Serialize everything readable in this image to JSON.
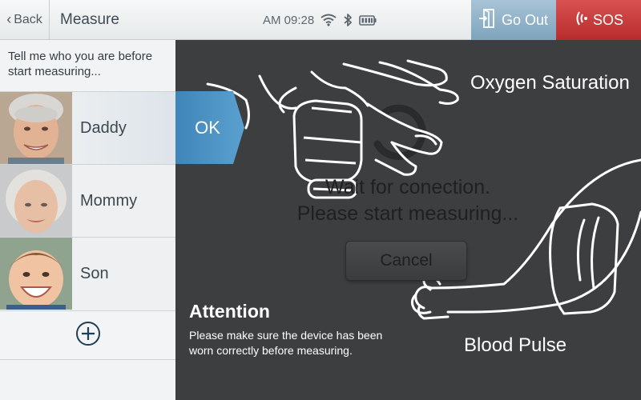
{
  "header": {
    "back_label": "Back",
    "title": "Measure",
    "time": "AM 09:28",
    "goout_label": "Go Out",
    "sos_label": "SOS",
    "icons": {
      "back": "chevron-left-icon",
      "wifi": "wifi-icon",
      "bluetooth": "bluetooth-icon",
      "battery": "battery-icon",
      "goout": "exit-door-icon",
      "sos": "sos-signal-icon"
    },
    "colors": {
      "goout": "#8aaec6",
      "sos": "#c83a3a"
    }
  },
  "sidebar": {
    "prompt": "Tell me who you are before start measuring...",
    "profiles": [
      {
        "name": "Daddy",
        "selected": true
      },
      {
        "name": "Mommy",
        "selected": false
      },
      {
        "name": "Son",
        "selected": false
      }
    ],
    "add_icon": "plus-circle-icon"
  },
  "main": {
    "ok_label": "OK",
    "message_line1": "Wait for conection.",
    "message_line2": "Please start measuring...",
    "cancel_label": "Cancel",
    "label_oxygen": "Oxygen Saturation",
    "label_pulse": "Blood Pulse",
    "attention_title": "Attention",
    "attention_body": "Please make sure the device has been worn correctly before measuring.",
    "icons": {
      "spinner": "loading-spinner-icon",
      "finger_sensor": "finger-oximeter-illustration",
      "arm_cuff": "arm-blood-pressure-cuff-illustration"
    },
    "colors": {
      "background": "#3d3e3f",
      "accent": "#4a8fc0"
    }
  }
}
